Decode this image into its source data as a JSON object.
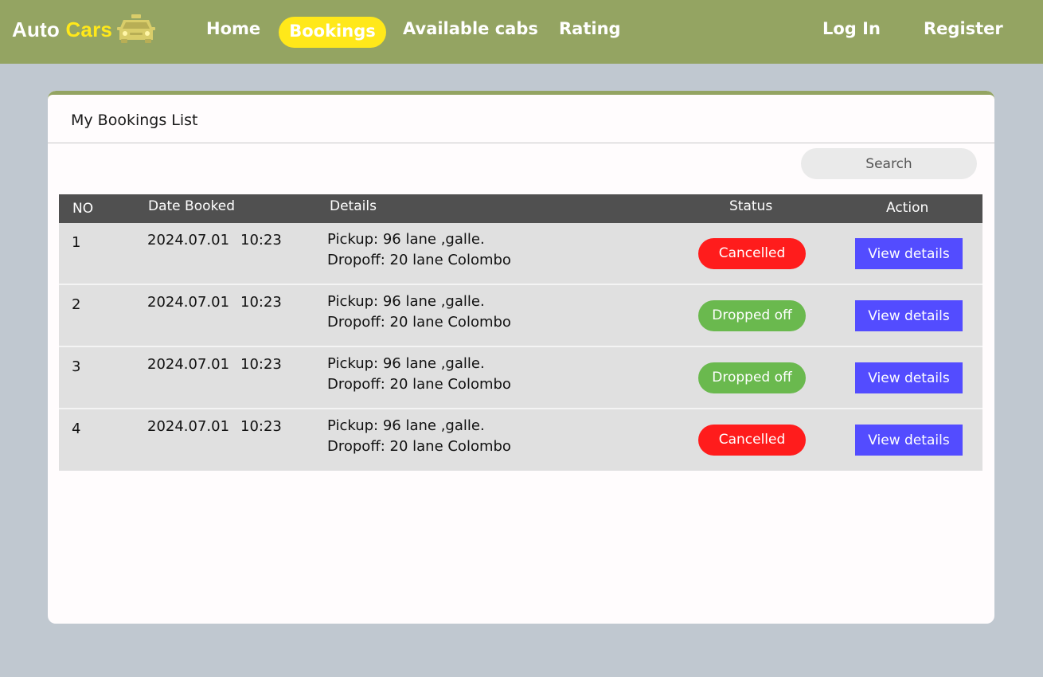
{
  "brand": {
    "part1": "Auto",
    "part2": "Cars",
    "logo_icon": "taxi-icon"
  },
  "nav": {
    "home": "Home",
    "bookings": "Bookings",
    "available_cabs": "Available cabs",
    "rating": "Rating",
    "login": "Log In",
    "register": "Register"
  },
  "colors": {
    "header": "#94a462",
    "active_pill": "#ffe81a",
    "cancelled": "#ff1c1c",
    "dropped_off": "#6ab94e",
    "action_button": "#534cff"
  },
  "card": {
    "title": "My Bookings List"
  },
  "search": {
    "placeholder": "Search"
  },
  "table": {
    "headers": {
      "no": "NO",
      "date": "Date Booked",
      "details": "Details",
      "status": "Status",
      "action": "Action"
    },
    "rows": [
      {
        "no": "1",
        "date": "2024.07.01",
        "time": "10:23",
        "pickup": "Pickup: 96 lane ,galle.",
        "dropoff": "Dropoff: 20 lane Colombo",
        "status": "Cancelled",
        "action": "View details"
      },
      {
        "no": "2",
        "date": "2024.07.01",
        "time": "10:23",
        "pickup": "Pickup: 96 lane ,galle.",
        "dropoff": "Dropoff: 20 lane Colombo",
        "status": "Dropped off",
        "action": "View details"
      },
      {
        "no": "3",
        "date": "2024.07.01",
        "time": "10:23",
        "pickup": "Pickup: 96 lane ,galle.",
        "dropoff": "Dropoff: 20 lane Colombo",
        "status": "Dropped off",
        "action": "View details"
      },
      {
        "no": "4",
        "date": "2024.07.01",
        "time": "10:23",
        "pickup": "Pickup: 96 lane ,galle.",
        "dropoff": "Dropoff: 20 lane Colombo",
        "status": "Cancelled",
        "action": "View details"
      }
    ]
  }
}
